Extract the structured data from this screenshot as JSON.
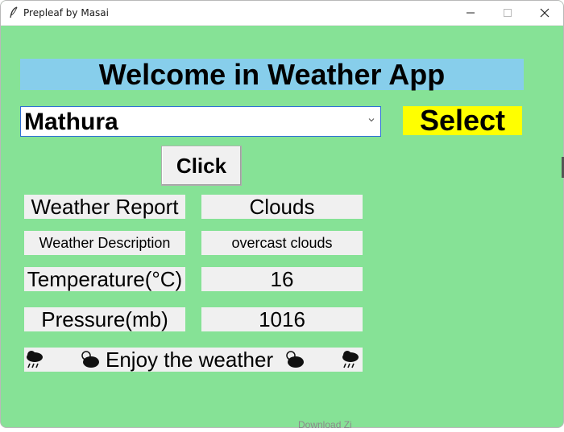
{
  "window": {
    "title": "Prepleaf by Masai",
    "controls": {
      "minimize": "—",
      "maximize": "☐",
      "close": "✕"
    }
  },
  "app": {
    "heading": "Welcome in Weather App",
    "city_select": {
      "value": "Mathura",
      "arrow": "chevron-down-icon"
    },
    "select_label": "Select",
    "click_button": "Click",
    "rows": [
      {
        "label": "Weather Report",
        "value": "Clouds"
      },
      {
        "label": "Weather Description",
        "value": "overcast clouds"
      },
      {
        "label": "Temperature(°C)",
        "value": "16"
      },
      {
        "label": "Pressure(mb)",
        "value": "1016"
      }
    ],
    "enjoy_text": "Enjoy the weather",
    "icons": [
      "cloud-rain-icon",
      "sun-cloud-icon",
      "sun-cloud-icon",
      "cloud-rain-icon"
    ]
  },
  "background_text": "Download Zi",
  "colors": {
    "background": "#86e296",
    "heading_bg": "#87ceeb",
    "select_bg": "#ffff00",
    "cell_bg": "#f0f0f0"
  }
}
